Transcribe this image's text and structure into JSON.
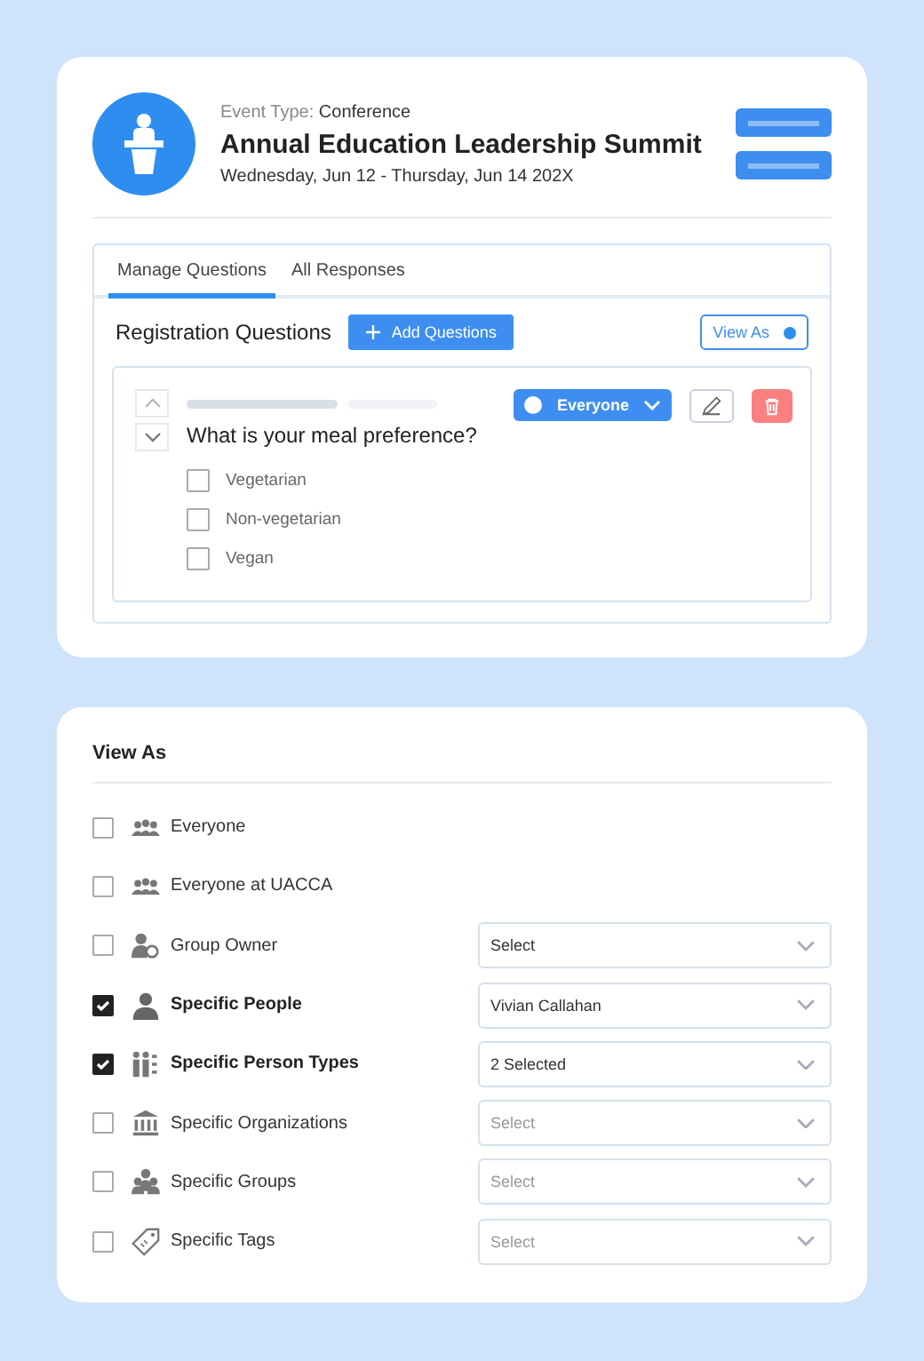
{
  "event": {
    "type_label": "Event Type:",
    "type_value": "Conference",
    "title": "Annual Education Leadership Summit",
    "dates": "Wednesday, Jun 12 - Thursday, Jun 14 202X"
  },
  "tabs": [
    {
      "label": "Manage Questions",
      "selected": true
    },
    {
      "label": "All Responses",
      "selected": false
    }
  ],
  "section": {
    "title": "Registration Questions",
    "add_button": "Add Questions",
    "view_as_button": "View As"
  },
  "question": {
    "text": "What is your meal preference?",
    "audience": "Everyone",
    "options": [
      {
        "label": "Vegetarian",
        "checked": false
      },
      {
        "label": "Non-vegetarian",
        "checked": false
      },
      {
        "label": "Vegan",
        "checked": false
      }
    ]
  },
  "view_as": {
    "title": "View As",
    "rows": [
      {
        "label": "Everyone",
        "checked": false
      },
      {
        "label": "Everyone at UACCA",
        "checked": false
      },
      {
        "label": "Group Owner",
        "checked": false,
        "value": "Select"
      },
      {
        "label": "Specific People",
        "checked": true,
        "value": "Vivian Callahan"
      },
      {
        "label": "Specific Person Types",
        "checked": true,
        "value": "2 Selected"
      },
      {
        "label": "Specific Organizations",
        "checked": false,
        "placeholder": "Select"
      },
      {
        "label": "Specific Groups",
        "checked": false,
        "placeholder": "Select"
      },
      {
        "label": "Specific Tags",
        "checked": false,
        "placeholder": "Select"
      }
    ]
  }
}
